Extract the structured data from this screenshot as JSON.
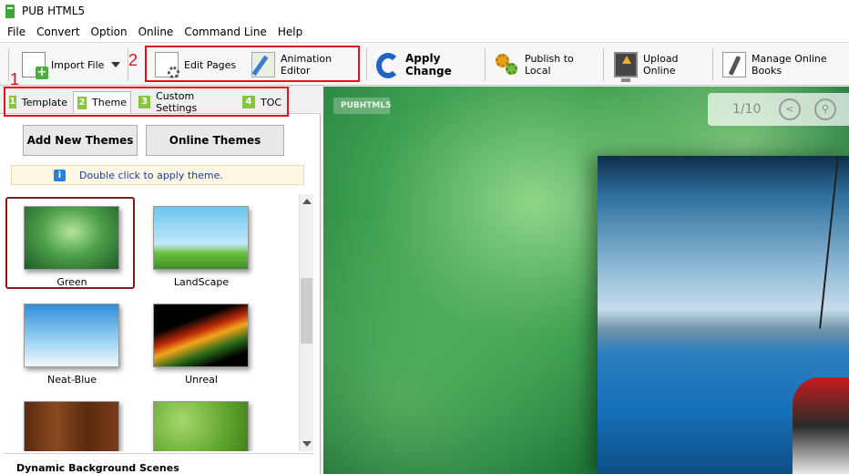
{
  "window": {
    "title": "PUB HTML5"
  },
  "menu": [
    "File",
    "Convert",
    "Option",
    "Online",
    "Command Line",
    "Help"
  ],
  "toolbar": {
    "import_file": "Import File",
    "edit_pages": "Edit Pages",
    "animation_editor": "Animation Editor",
    "apply_change": "Apply Change",
    "publish_local": "Publish to Local",
    "upload_online": "Upload Online",
    "manage_online": "Manage Online Books"
  },
  "annotations": {
    "one": "1",
    "two": "2"
  },
  "tabs": [
    {
      "num": "1",
      "label": "Template"
    },
    {
      "num": "2",
      "label": "Theme"
    },
    {
      "num": "3",
      "label": "Custom Settings"
    },
    {
      "num": "4",
      "label": "TOC"
    }
  ],
  "buttons": {
    "add_new_themes": "Add New Themes",
    "online_themes": "Online Themes"
  },
  "hint": {
    "icon": "i",
    "text": "Double click to apply theme."
  },
  "themes": [
    {
      "name": "Green",
      "selected": true
    },
    {
      "name": "LandScape"
    },
    {
      "name": "Neat-Blue"
    },
    {
      "name": "Unreal"
    },
    {
      "name": ""
    },
    {
      "name": ""
    }
  ],
  "section": {
    "dynamic_bg": "Dynamic Background Scenes"
  },
  "preview": {
    "logo": "PUBHTML5",
    "page_indicator": "1/10"
  },
  "colors": {
    "annotation": "#e0141e",
    "tab_number": "#86c540",
    "hint_text": "#1a3aa6"
  }
}
